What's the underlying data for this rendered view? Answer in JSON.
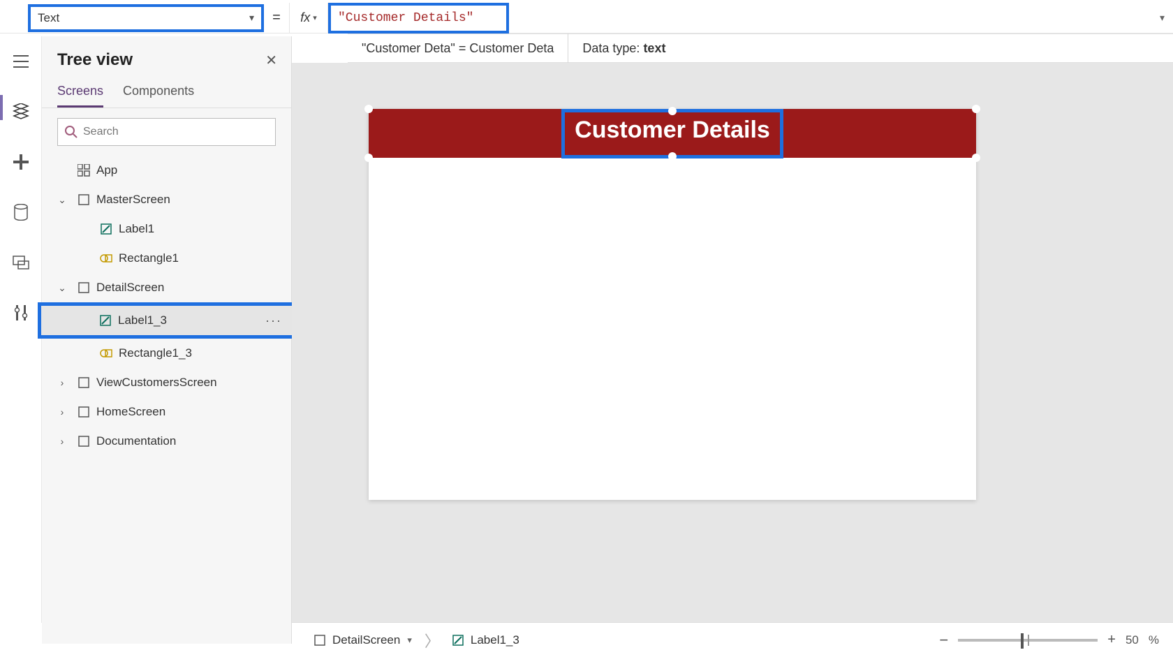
{
  "formula": {
    "property": "Text",
    "equals": "=",
    "fx": "fx",
    "value": "\"Customer Details\"",
    "intelli_left": "\"Customer Deta\"  =  Customer Deta",
    "intelli_type_label": "Data type: ",
    "intelli_type_value": "text"
  },
  "tree": {
    "title": "Tree view",
    "tabs": {
      "screens": "Screens",
      "components": "Components"
    },
    "search_placeholder": "Search",
    "items": [
      {
        "label": "App",
        "icon": "grid",
        "indent": 0
      },
      {
        "label": "MasterScreen",
        "icon": "screen",
        "indent": 1,
        "caret": "down"
      },
      {
        "label": "Label1",
        "icon": "label",
        "indent": 2
      },
      {
        "label": "Rectangle1",
        "icon": "rect",
        "indent": 2
      },
      {
        "label": "DetailScreen",
        "icon": "screen",
        "indent": 1,
        "caret": "down"
      },
      {
        "label": "Label1_3",
        "icon": "label",
        "indent": 2,
        "selected": true
      },
      {
        "label": "Rectangle1_3",
        "icon": "rect",
        "indent": 2
      },
      {
        "label": "ViewCustomersScreen",
        "icon": "screen",
        "indent": 1,
        "caret": "right"
      },
      {
        "label": "HomeScreen",
        "icon": "screen",
        "indent": 1,
        "caret": "right"
      },
      {
        "label": "Documentation",
        "icon": "screen",
        "indent": 1,
        "caret": "right"
      }
    ]
  },
  "canvas": {
    "header_text": "Customer Details"
  },
  "breadcrumb": {
    "screen": "DetailScreen",
    "control": "Label1_3"
  },
  "zoom": {
    "minus": "−",
    "plus": "+",
    "value": "50",
    "pct": "%"
  }
}
